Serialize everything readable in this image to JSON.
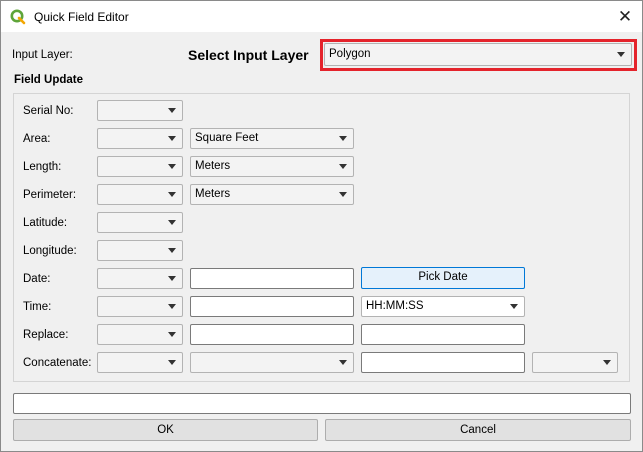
{
  "window": {
    "title": "Quick Field Editor",
    "close_glyph": "✕"
  },
  "input_layer": {
    "label": "Input Layer:",
    "heading": "Select Input Layer",
    "value": "Polygon"
  },
  "field_update": {
    "title": "Field Update",
    "rows": [
      {
        "label": "Serial No:"
      },
      {
        "label": "Area:",
        "unit": "Square Feet"
      },
      {
        "label": "Length:",
        "unit": "Meters"
      },
      {
        "label": "Perimeter:",
        "unit": "Meters"
      },
      {
        "label": "Latitude:"
      },
      {
        "label": "Longitude:"
      },
      {
        "label": "Date:",
        "button": "Pick Date"
      },
      {
        "label": "Time:",
        "format": "HH:MM:SS"
      },
      {
        "label": "Replace:"
      },
      {
        "label": "Concatenate:"
      }
    ]
  },
  "footer": {
    "ok": "OK",
    "cancel": "Cancel"
  },
  "colors": {
    "highlight": "#e4232b",
    "app_icon_green": "#5ea53a",
    "focus_border": "#0078d7"
  }
}
